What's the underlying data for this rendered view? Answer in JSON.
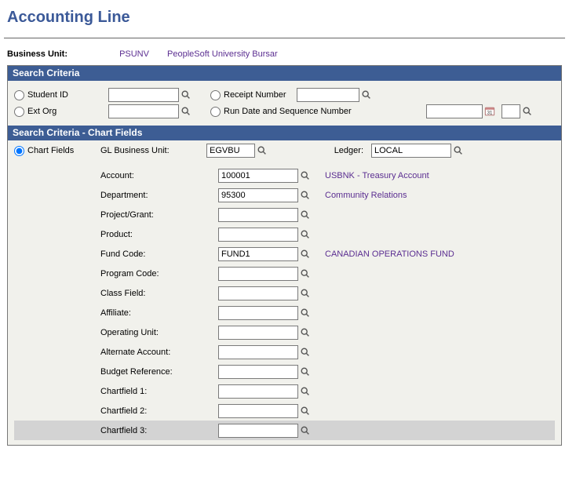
{
  "pageTitle": "Accounting Line",
  "bu": {
    "label": "Business Unit:",
    "value": "PSUNV",
    "name": "PeopleSoft University Bursar"
  },
  "bars": {
    "criteria": "Search Criteria",
    "chartfields": "Search Criteria - Chart Fields"
  },
  "criteria": {
    "studentId": {
      "label": "Student ID",
      "value": ""
    },
    "extOrg": {
      "label": "Ext Org",
      "value": ""
    },
    "receipt": {
      "label": "Receipt Number",
      "value": ""
    },
    "runDate": {
      "label": "Run Date and Sequence Number",
      "date": "",
      "seq": ""
    }
  },
  "cf": {
    "radioLabel": "Chart Fields",
    "glbuLabel": "GL Business Unit:",
    "glbu": "EGVBU",
    "ledgerLabel": "Ledger:",
    "ledger": "LOCAL",
    "rows": [
      {
        "label": "Account:",
        "value": "100001",
        "desc": "USBNK - Treasury Account"
      },
      {
        "label": "Department:",
        "value": "95300",
        "desc": "Community Relations"
      },
      {
        "label": "Project/Grant:",
        "value": "",
        "desc": ""
      },
      {
        "label": "Product:",
        "value": "",
        "desc": ""
      },
      {
        "label": "Fund Code:",
        "value": "FUND1",
        "desc": "CANADIAN OPERATIONS FUND"
      },
      {
        "label": "Program Code:",
        "value": "",
        "desc": ""
      },
      {
        "label": "Class Field:",
        "value": "",
        "desc": ""
      },
      {
        "label": "Affiliate:",
        "value": "",
        "desc": ""
      },
      {
        "label": "Operating Unit:",
        "value": "",
        "desc": ""
      },
      {
        "label": "Alternate Account:",
        "value": "",
        "desc": ""
      },
      {
        "label": "Budget Reference:",
        "value": "",
        "desc": ""
      },
      {
        "label": "Chartfield 1:",
        "value": "",
        "desc": ""
      },
      {
        "label": "Chartfield 2:",
        "value": "",
        "desc": ""
      },
      {
        "label": "Chartfield 3:",
        "value": "",
        "desc": ""
      }
    ]
  }
}
